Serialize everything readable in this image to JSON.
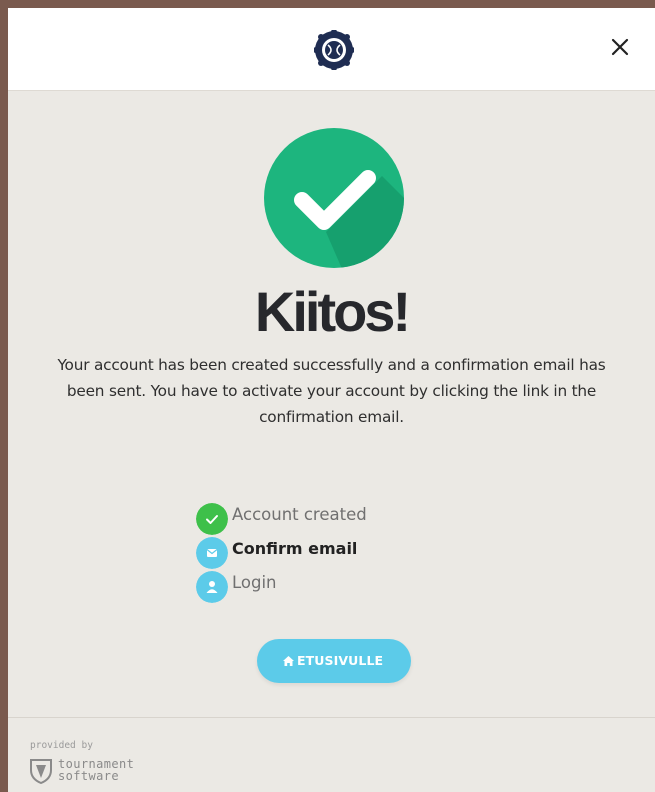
{
  "header": {
    "logo_icon": "federation-crest-icon",
    "close_icon": "close-icon"
  },
  "main": {
    "title": "Kiitos!",
    "message": "Your account has been created successfully and a confirmation email has been sent. You have to activate your account by clicking the link in the confirmation email.",
    "success_icon": "check-circle-icon"
  },
  "steps": [
    {
      "label": "Account created",
      "icon": "check-icon",
      "state": "done",
      "color": "#3ec04a"
    },
    {
      "label": "Confirm email",
      "icon": "envelope-icon",
      "state": "active",
      "color": "#5ccbe9"
    },
    {
      "label": "Login",
      "icon": "user-icon",
      "state": "pending",
      "color": "#5ccbe9"
    }
  ],
  "home_button": {
    "label": "ETUSIVULLE",
    "icon": "home-icon"
  },
  "footer": {
    "provided_by": "provided by",
    "brand_line1": "tournament",
    "brand_line2": "software"
  },
  "colors": {
    "success_green": "#1db57e",
    "accent_blue": "#5ccbe9",
    "background": "#ebe9e4"
  }
}
